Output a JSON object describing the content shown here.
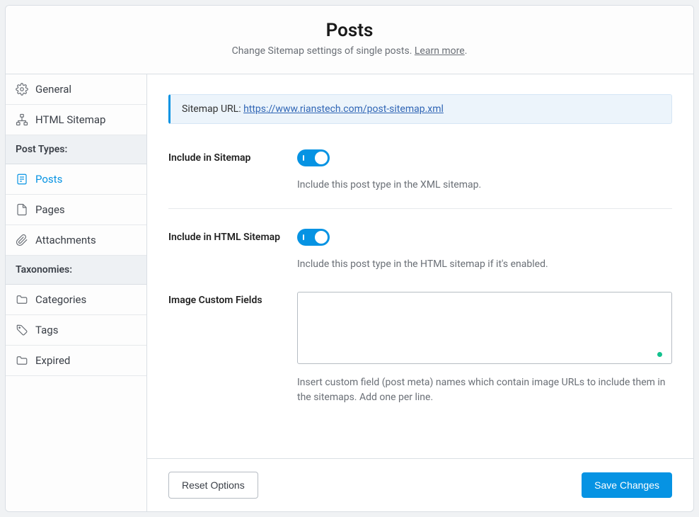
{
  "header": {
    "title": "Posts",
    "subtitle_before": "Change Sitemap settings of single posts. ",
    "learn_more": "Learn more",
    "subtitle_after": "."
  },
  "sidebar": {
    "general": "General",
    "html_sitemap": "HTML Sitemap",
    "section_post_types": "Post Types:",
    "posts": "Posts",
    "pages": "Pages",
    "attachments": "Attachments",
    "section_taxonomies": "Taxonomies:",
    "categories": "Categories",
    "tags": "Tags",
    "expired": "Expired"
  },
  "notice": {
    "label": "Sitemap URL: ",
    "url": "https://www.rianstech.com/post-sitemap.xml"
  },
  "fields": {
    "include_sitemap": {
      "label": "Include in Sitemap",
      "help": "Include this post type in the XML sitemap."
    },
    "include_html_sitemap": {
      "label": "Include in HTML Sitemap",
      "help": "Include this post type in the HTML sitemap if it's enabled."
    },
    "image_custom_fields": {
      "label": "Image Custom Fields",
      "value": "",
      "help": "Insert custom field (post meta) names which contain image URLs to include them in the sitemaps. Add one per line."
    }
  },
  "footer": {
    "reset": "Reset Options",
    "save": "Save Changes"
  }
}
